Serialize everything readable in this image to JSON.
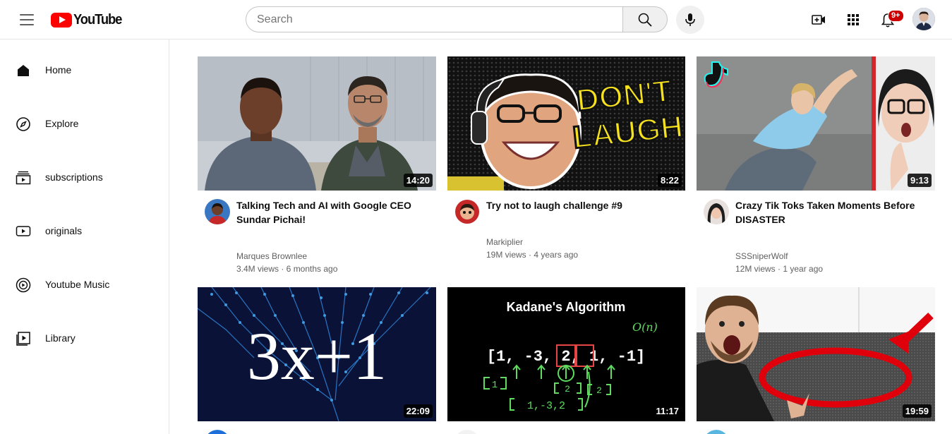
{
  "header": {
    "logo_text": "YouTube",
    "search_placeholder": "Search",
    "notification_badge": "9+"
  },
  "sidebar": {
    "items": [
      {
        "label": "Home",
        "icon": "home-icon"
      },
      {
        "label": "Explore",
        "icon": "compass-icon"
      },
      {
        "label": "subscriptions",
        "icon": "subscriptions-icon"
      },
      {
        "label": "originals",
        "icon": "originals-icon"
      },
      {
        "label": "Youtube Music",
        "icon": "music-icon"
      },
      {
        "label": "Library",
        "icon": "library-icon"
      }
    ]
  },
  "videos": [
    {
      "title": "Talking Tech and AI with Google CEO Sundar Pichai!",
      "channel": "Marques Brownlee",
      "meta": "3.4M views · 6 months ago",
      "duration": "14:20"
    },
    {
      "title": "Try not to laugh challenge #9",
      "channel": "Markiplier",
      "meta": "19M views · 4 years ago",
      "duration": "8:22",
      "thumb_text": [
        "DON'T",
        "LAUGH"
      ]
    },
    {
      "title": "Crazy Tik Toks Taken Moments Before DISASTER",
      "channel": "SSSniperWolf",
      "meta": "12M views · 1 year ago",
      "duration": "9:13"
    },
    {
      "duration": "22:09",
      "thumb_text": "3x+1"
    },
    {
      "duration": "11:17",
      "thumb_text": "Kadane's Algorithm",
      "thumb_array": "[1, -3, 2, 1, -1]"
    },
    {
      "duration": "19:59"
    }
  ]
}
